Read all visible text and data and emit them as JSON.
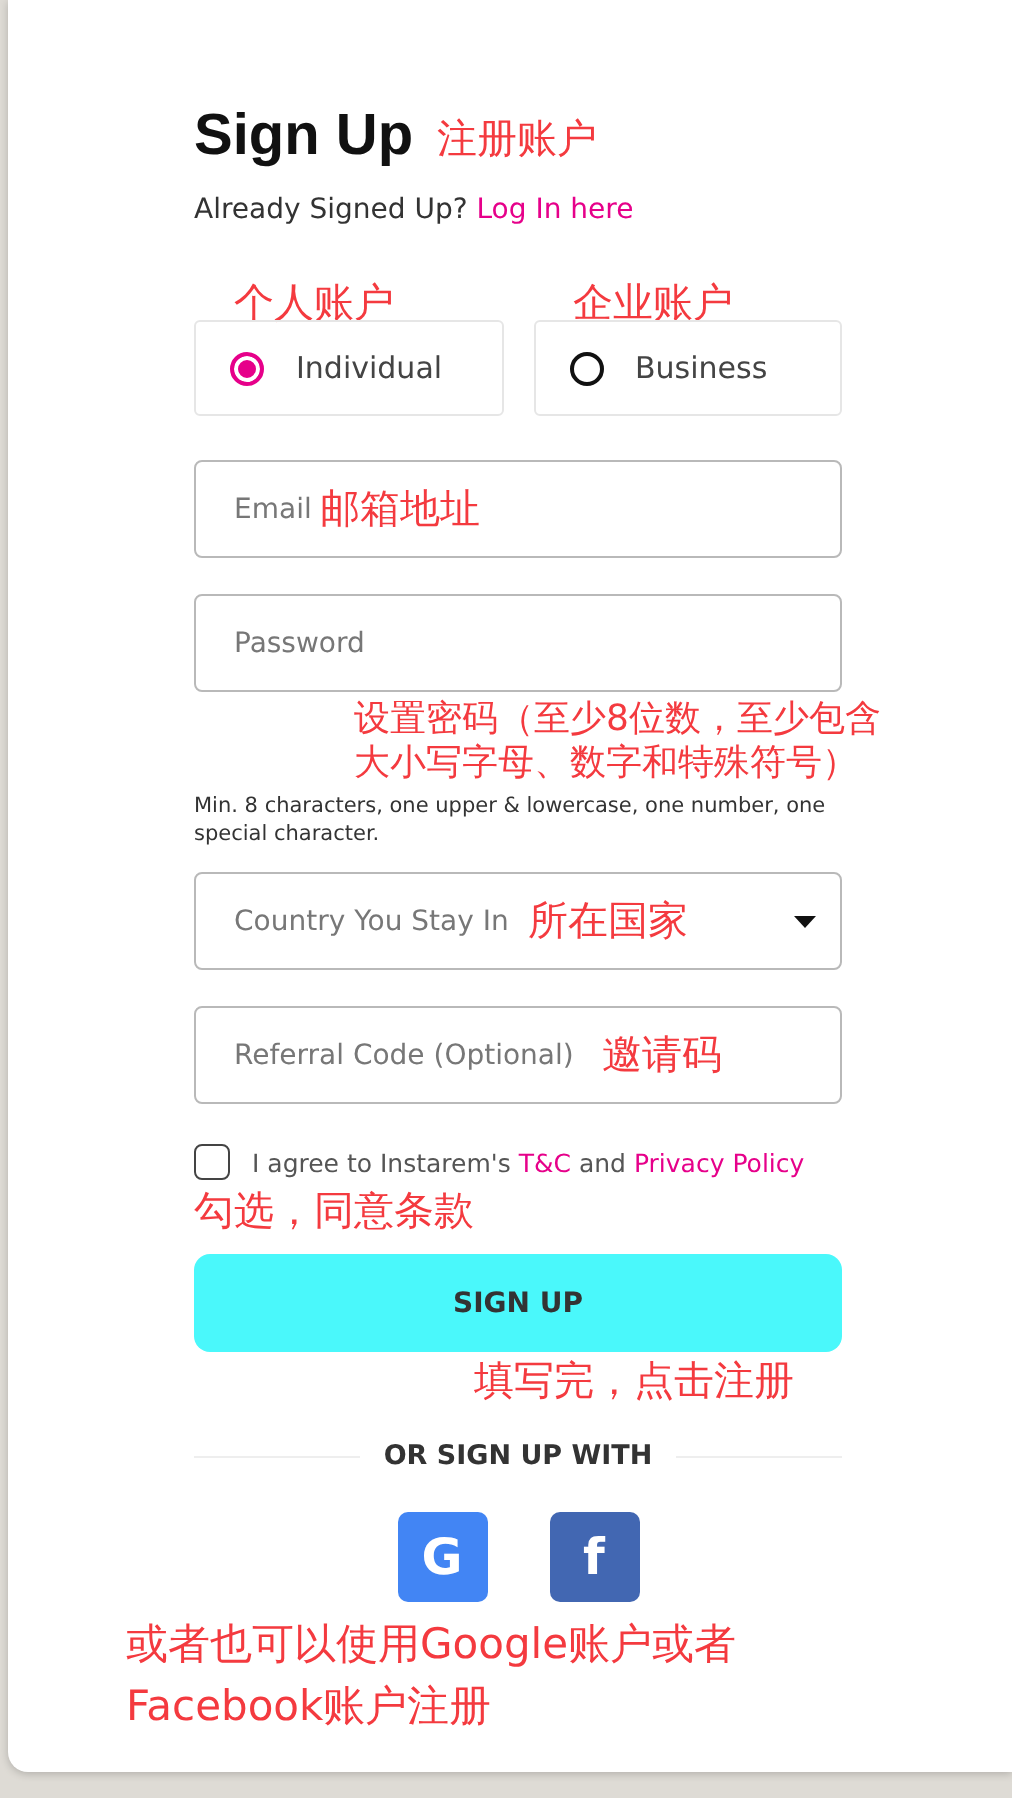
{
  "header": {
    "title": "Sign Up",
    "title_note": "注册账户",
    "prompt": "Already Signed Up?",
    "login_link": "Log In here"
  },
  "account_types": [
    {
      "label": "Individual",
      "note": "个人账户",
      "selected": true
    },
    {
      "label": "Business",
      "note": "企业账户",
      "selected": false
    }
  ],
  "fields": [
    {
      "kind": "text",
      "placeholder": "Email",
      "note": "邮箱地址"
    },
    {
      "kind": "password",
      "placeholder": "Password",
      "note": "设置密码（至少8位数，至少包含大小写字母、数字和特殊符号）",
      "hint": "Min. 8 characters, one upper & lowercase, one number, one special character."
    },
    {
      "kind": "select",
      "placeholder": "Country You Stay In",
      "note": "所在国家"
    },
    {
      "kind": "text",
      "placeholder": "Referral Code (Optional)",
      "note": "邀请码"
    }
  ],
  "agreement": {
    "checked": false,
    "text_before": "I agree to Instarem's",
    "terms_link": "T&C",
    "joiner": "and",
    "privacy_link": "Privacy Policy",
    "note": "勾选，同意条款"
  },
  "submit": {
    "label": "SIGN UP",
    "note": "填写完，点击注册"
  },
  "social": {
    "heading": "OR SIGN UP WITH",
    "providers": [
      {
        "kind": "google",
        "letter": "G"
      },
      {
        "kind": "facebook",
        "letter": "f"
      }
    ],
    "note": "或者也可以使用Google账户或者Facebook账户注册"
  }
}
